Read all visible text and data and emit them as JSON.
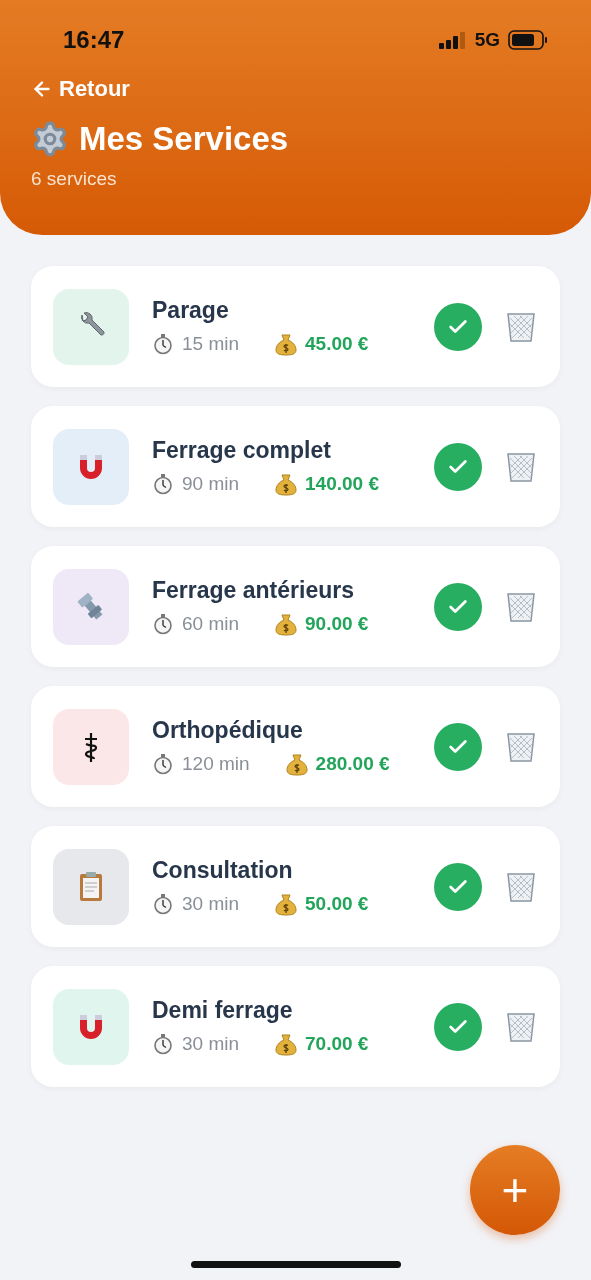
{
  "status_bar": {
    "time": "16:47",
    "network": "5G"
  },
  "header": {
    "back": "Retour",
    "title": "Mes Services",
    "subtitle": "6 services"
  },
  "services": [
    {
      "kind": "wrench",
      "color": "#e3f4ec",
      "name": "Parage",
      "duration": "15 min",
      "price": "45.00 €",
      "active": true
    },
    {
      "kind": "magnet",
      "color": "#e3eef9",
      "name": "Ferrage complet",
      "duration": "90 min",
      "price": "140.00 €",
      "active": true
    },
    {
      "kind": "bolt",
      "color": "#efe8f7",
      "name": "Ferrage antérieurs",
      "duration": "60 min",
      "price": "90.00 €",
      "active": true
    },
    {
      "kind": "caduceus",
      "color": "#fbe7e8",
      "name": "Orthopédique",
      "duration": "120 min",
      "price": "280.00 €",
      "active": true
    },
    {
      "kind": "clipboard",
      "color": "#e6e8eb",
      "name": "Consultation",
      "duration": "30 min",
      "price": "50.00 €",
      "active": true
    },
    {
      "kind": "magnet",
      "color": "#e1f5ef",
      "name": "Demi ferrage",
      "duration": "30 min",
      "price": "70.00 €",
      "active": true
    }
  ],
  "fab": "+"
}
